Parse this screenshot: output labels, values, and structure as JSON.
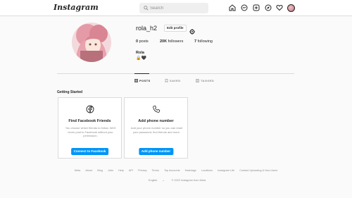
{
  "nav": {
    "logo": "Instagram",
    "search_placeholder": "Search",
    "icons": [
      "home-icon",
      "messenger-icon",
      "new-post-icon",
      "explore-icon",
      "activity-heart-icon",
      "profile-avatar"
    ]
  },
  "profile": {
    "username": "rola_h2",
    "edit_label": "Edit profile",
    "posts_count": "0",
    "posts_label": "posts",
    "followers_count": "20K",
    "followers_label": "followers",
    "following_count": "7",
    "following_label": "following",
    "full_name": "Rola",
    "bio": "🔒🖤"
  },
  "tabs": [
    {
      "label": "POSTS",
      "active": true
    },
    {
      "label": "SAVED",
      "active": false
    },
    {
      "label": "TAGGED",
      "active": false
    }
  ],
  "getting_started": {
    "title": "Getting Started",
    "cards": [
      {
        "title": "Find Facebook Friends",
        "description": "You choose which friends to follow. We'll never post to Facebook without your permission.",
        "button": "Connect to Facebook"
      },
      {
        "title": "Add phone number",
        "description": "Add your phone number so you can reset your password, find friends and more.",
        "button": "Add phone number"
      }
    ]
  },
  "footer": {
    "links": [
      "Meta",
      "About",
      "Blog",
      "Jobs",
      "Help",
      "API",
      "Privacy",
      "Terms",
      "Top Accounts",
      "Hashtags",
      "Locations",
      "Instagram Lite",
      "Contact Uploading & Non-Users"
    ],
    "language": "English",
    "copyright": "© 2022 Instagram from Meta"
  },
  "colors": {
    "accent": "#0095f6",
    "text": "#262626",
    "muted": "#8e8e8e",
    "border": "#dbdbdb"
  }
}
